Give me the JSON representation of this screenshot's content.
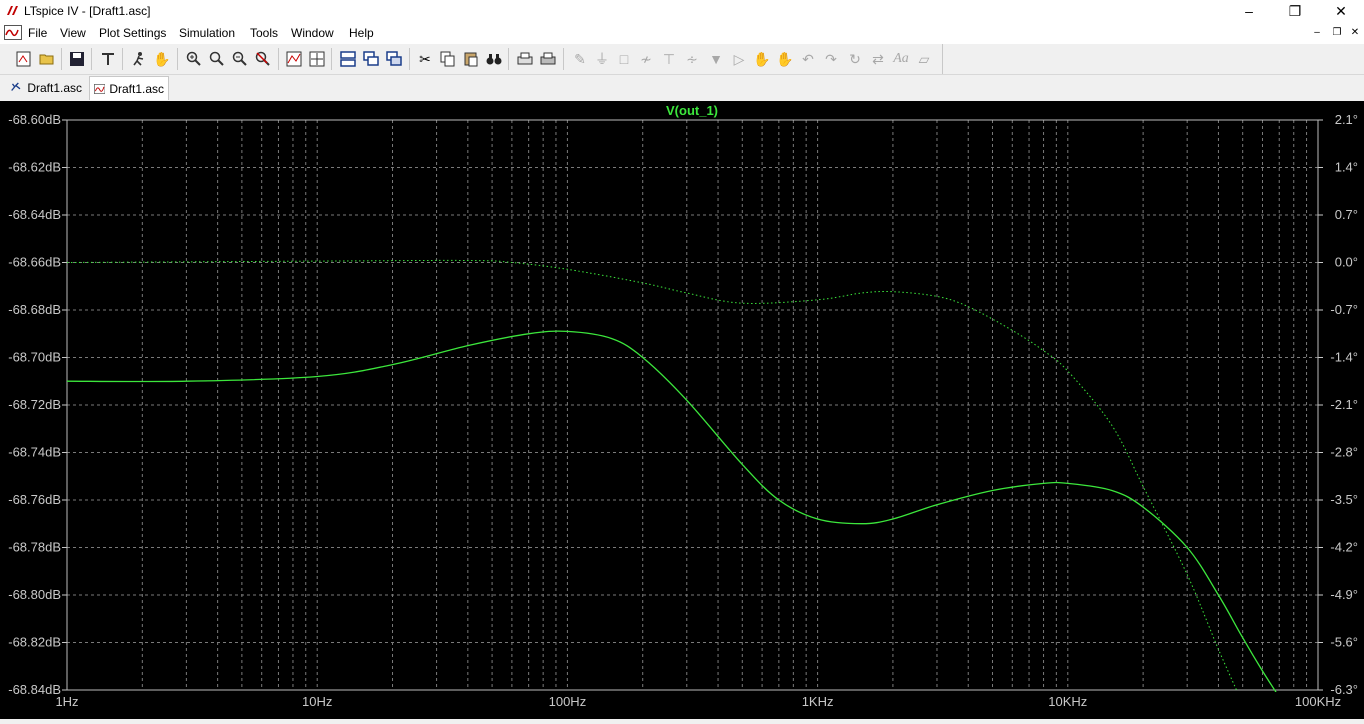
{
  "window": {
    "title": "LTspice IV - [Draft1.asc]"
  },
  "menu": [
    "File",
    "View",
    "Plot Settings",
    "Simulation",
    "Tools",
    "Window",
    "Help"
  ],
  "toolbar": {
    "buttons": [
      "new-schematic",
      "open",
      "save",
      "control-panel",
      "run",
      "halt",
      "zoom-in",
      "zoom-pan",
      "zoom-out",
      "zoom-cancel",
      "autoscale",
      "zoom-full",
      "tile-horizontal",
      "cascade",
      "tile-vertical",
      "cut",
      "copy",
      "paste",
      "find",
      "print-setup",
      "print",
      "wire",
      "ground",
      "label",
      "resistor",
      "capacitor",
      "inductor",
      "diode",
      "component",
      "move",
      "drag",
      "undo",
      "redo",
      "rotate",
      "mirror",
      "text",
      "spice-directive"
    ]
  },
  "tabs": [
    {
      "label": "Draft1.asc",
      "kind": "schematic",
      "active": false
    },
    {
      "label": "Draft1.asc",
      "kind": "waveform",
      "active": true
    }
  ],
  "colors": {
    "trace": "#3ce63c",
    "axis_text": "#c8c8c8",
    "grid": "#7a7a7a",
    "background": "#000000"
  },
  "chart_data": {
    "type": "line",
    "title": "V(out_1)",
    "x_scale": "log",
    "xlim": [
      1,
      100000
    ],
    "x_ticks": [
      "1Hz",
      "10Hz",
      "100Hz",
      "1KHz",
      "10KHz",
      "100KHz"
    ],
    "y_left_ticks": [
      "-68.60dB",
      "-68.62dB",
      "-68.64dB",
      "-68.66dB",
      "-68.68dB",
      "-68.70dB",
      "-68.72dB",
      "-68.74dB",
      "-68.76dB",
      "-68.78dB",
      "-68.80dB",
      "-68.82dB",
      "-68.84dB"
    ],
    "y_right_ticks": [
      "2.1°",
      "1.4°",
      "0.7°",
      "0.0°",
      "-0.7°",
      "-1.4°",
      "-2.1°",
      "-2.8°",
      "-3.5°",
      "-4.2°",
      "-4.9°",
      "-5.6°",
      "-6.3°"
    ],
    "ylim_left": [
      -68.84,
      -68.6
    ],
    "ylim_right": [
      -6.3,
      2.1
    ],
    "grid": true,
    "series": [
      {
        "name": "V(out_1)",
        "axis": "left",
        "style": "solid",
        "x": [
          1,
          3,
          10,
          20,
          40,
          70,
          100,
          150,
          200,
          300,
          500,
          700,
          1000,
          1500,
          2000,
          3000,
          5000,
          8000,
          10000,
          15000,
          20000,
          30000,
          40000,
          50000,
          60000,
          70000
        ],
        "y": [
          -68.71,
          -68.71,
          -68.708,
          -68.703,
          -68.695,
          -68.69,
          -68.689,
          -68.692,
          -68.7,
          -68.718,
          -68.745,
          -68.76,
          -68.768,
          -68.77,
          -68.768,
          -68.762,
          -68.756,
          -68.753,
          -68.753,
          -68.756,
          -68.763,
          -68.78,
          -68.8,
          -68.818,
          -68.832,
          -68.843
        ]
      },
      {
        "name": "V(out_1) phase",
        "axis": "right",
        "style": "dotted",
        "x": [
          1,
          10,
          40,
          60,
          100,
          200,
          300,
          500,
          1000,
          1500,
          2000,
          3000,
          4000,
          6000,
          8000,
          10000,
          15000,
          20000,
          30000,
          40000,
          50000
        ],
        "y": [
          0.0,
          0.02,
          0.03,
          0.0,
          -0.1,
          -0.3,
          -0.45,
          -0.6,
          -0.55,
          -0.45,
          -0.43,
          -0.5,
          -0.65,
          -1.0,
          -1.3,
          -1.6,
          -2.4,
          -3.3,
          -4.6,
          -5.7,
          -6.5
        ]
      }
    ]
  }
}
